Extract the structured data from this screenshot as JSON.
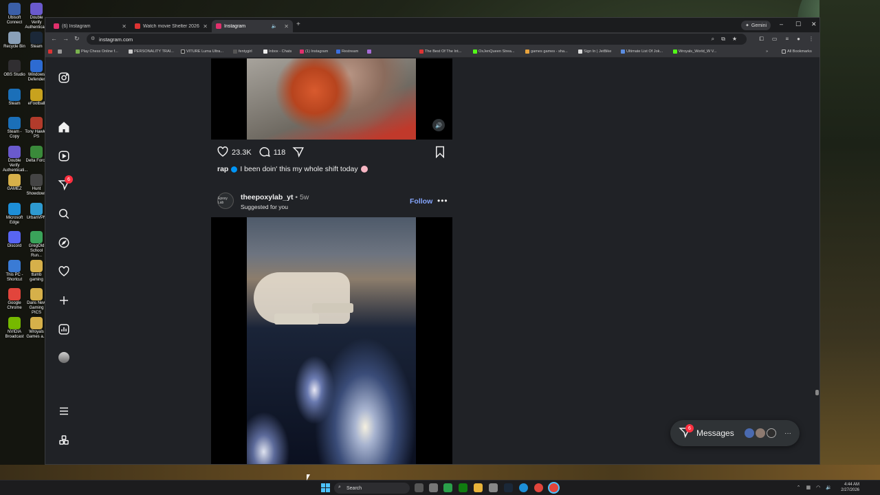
{
  "desktop": {
    "icons": [
      {
        "label": "Ubisoft Connect",
        "color": "#3b5fa8"
      },
      {
        "label": "Double Verify Authentica...",
        "color": "#6a5acd"
      },
      {
        "label": "Recycle Bin",
        "color": "#8aa0b8"
      },
      {
        "label": "Steam",
        "color": "#1b2838"
      },
      {
        "label": "OBS Studio",
        "color": "#302e31"
      },
      {
        "label": "Windows Defender",
        "color": "#2d6bd2"
      },
      {
        "label": "Steam",
        "color": "#1b6fb8"
      },
      {
        "label": "eFootball",
        "color": "#c8a21e"
      },
      {
        "label": "Steam - Copy",
        "color": "#1b6fb8"
      },
      {
        "label": "Tony Hawk's PS",
        "color": "#b23b2b"
      },
      {
        "label": "Double Verify Authenticati...",
        "color": "#6a5acd"
      },
      {
        "label": "Delta Force",
        "color": "#3a8a3a"
      },
      {
        "label": "GAMEZ",
        "color": "#d6b04a"
      },
      {
        "label": "Hunt Showdown",
        "color": "#444444"
      },
      {
        "label": "Microsoft Edge",
        "color": "#1d8fd8"
      },
      {
        "label": "UrbanVPN",
        "color": "#2e9ad0"
      },
      {
        "label": "Discord",
        "color": "#5865f2"
      },
      {
        "label": "GregOld School Run...",
        "color": "#3aa35a"
      },
      {
        "label": "This PC - Shortcut",
        "color": "#3a7bd5"
      },
      {
        "label": "ttumb gaming",
        "color": "#d6b04a"
      },
      {
        "label": "Google Chrome",
        "color": "#e2453c"
      },
      {
        "label": "Dans New Gaming PICS",
        "color": "#d6b04a"
      },
      {
        "label": "NVIDIA Broadcast",
        "color": "#76b900"
      },
      {
        "label": "Wroyals Games a...",
        "color": "#d6b04a"
      }
    ]
  },
  "browser": {
    "tabs": [
      {
        "title": "(6) Instagram",
        "active": false
      },
      {
        "title": "Watch movie Shelter 2026 on I...",
        "active": false
      },
      {
        "title": "Instagram",
        "active": true
      }
    ],
    "gemini_label": "Gemini",
    "url": "instagram.com",
    "bookmarks": [
      "Play Chess Online f...",
      "PERSONALITY TRAI...",
      "VITURE Luma Ultra...",
      "fentygirl",
      "Inbox - Chats",
      "(1) Instagram",
      "Restream",
      "The Best Of The Int...",
      "OxJenQueen Strea...",
      "games games - sha...",
      "Sign In | JetBike",
      "Ultimate List Of Jok...",
      "Wroyals_World_W V...",
      "All Bookmarks"
    ]
  },
  "instagram": {
    "sidebar": {
      "notifications_badge": "6"
    },
    "post1": {
      "likes": "23.3K",
      "comments": "118",
      "caption_user": "rap",
      "caption_text": "I been doin' this my whole shift today"
    },
    "post2": {
      "username": "theepoxylab_yt",
      "time": "• 5w",
      "subtitle": "Suggested for you",
      "follow_label": "Follow",
      "more_label": "•••",
      "avatar_text": "Epoxy Lab"
    },
    "messages": {
      "label": "Messages",
      "badge": "6",
      "more": "···"
    }
  },
  "taskbar": {
    "search_label": "Search",
    "time": "4:44 AM",
    "date": "2/27/2026"
  }
}
